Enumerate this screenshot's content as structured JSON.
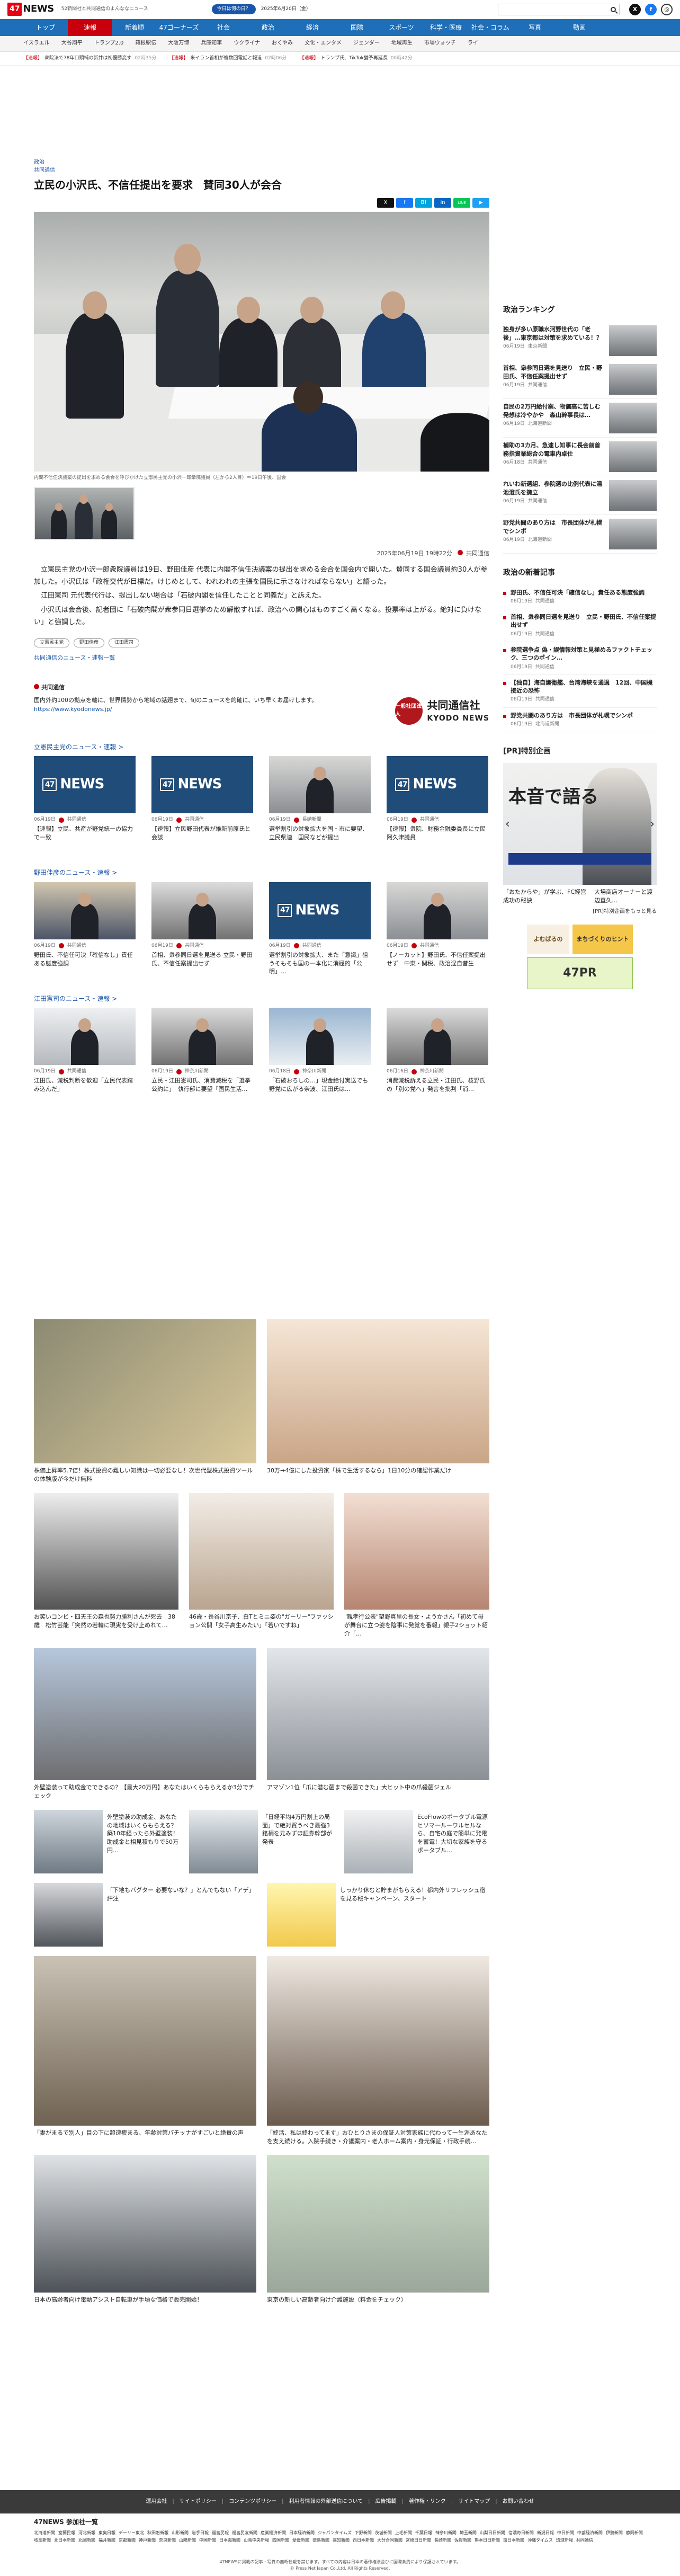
{
  "header": {
    "logo_num": "47",
    "logo_text": "NEWS",
    "tagline": "52新聞社と共同通信のよんななニュース",
    "today_btn": "今日は何の日？",
    "date": "2025年6月20日（金）",
    "search_placeholder": ""
  },
  "nav": {
    "items": [
      "トップ",
      "速報",
      "新着順",
      "47ゴーナーズ",
      "社会",
      "政治",
      "経済",
      "国際",
      "スポーツ",
      "科学・医療",
      "社会・コラム",
      "写真",
      "動画"
    ],
    "active": "速報"
  },
  "subnav": [
    "イスラエル",
    "大谷翔平",
    "トランプ2.0",
    "箱根駅伝",
    "大阪万博",
    "兵庫知事",
    "ウクライナ",
    "おくやみ",
    "文化・エンタメ",
    "ジェンダー",
    "地域再生",
    "市場ウォッチ",
    "ライ"
  ],
  "ticker": [
    {
      "tag": "【速報】",
      "text": "衆院法で78年口頭補の新井は初優勝変す",
      "time": "02時35分"
    },
    {
      "tag": "【速報】",
      "text": "米イラン首相が複数回電話と報道",
      "time": "02時06分"
    },
    {
      "tag": "【速報】",
      "text": "トランプ氏、TikTok猶予再延長",
      "time": "00時42分"
    }
  ],
  "article": {
    "cats": [
      "政治",
      "共同通信"
    ],
    "headline": "立民の小沢氏、不信任提出を要求　賛同30人が会合",
    "caption": "内閣不信任決議案の提出を求める会合を呼びかけた立憲民主党の小沢一郎衆院議員（左から2人目）＝19日午後、国会",
    "byline_date": "2025年06月19日 19時22分",
    "byline_src": "共同通信",
    "paragraphs": [
      "立憲民主党の小沢一郎衆院議員は19日、野田佳彦 代表に内閣不信任決議案の提出を求める会合を国会内で開いた。賛同する国会議員約30人が参加した。小沢氏は「政権交代が目標だ。けじめとして、われわれの主張を国民に示さなければならない」と語った。",
      "江田憲司 元代表代行は、提出しない場合は「石破内閣を信任したことと同義だ」と訴えた。",
      "小沢氏は会合後、記者団に「石破内閣が衆参同日選挙のため解散すれば、政治への関心はものすごく高くなる。投票率は上がる。絶対に負けない」と強調した。"
    ],
    "tags": [
      "立憲民主党",
      "野田佳彦",
      "江田憲司"
    ],
    "more_link": "共同通信のニュース・速報一覧"
  },
  "share": [
    "X",
    "f",
    "B!",
    "in",
    "LINE",
    "▶"
  ],
  "kyodo": {
    "title": "共同通信",
    "desc": "国内外約100の拠点を軸に、世界情勢から地域の話題まで、旬のニュースを的確に、いち早くお届けします。",
    "url": "https://www.kyodonews.jp/",
    "logo_circle": "一般社団法人",
    "logo_name": "共同通信社",
    "logo_en": "KYODO NEWS"
  },
  "sections": [
    {
      "title": "立憲民主党のニュース・速報 >",
      "cards": [
        {
          "img": "logo",
          "date": "06月19日",
          "src": "共同通信",
          "title": "【速報】立民、共産が野党統一の協力で一致"
        },
        {
          "img": "logo",
          "date": "06月19日",
          "src": "共同通信",
          "title": "【速報】立民野田代表が維新前原氏と会談"
        },
        {
          "img": "photo",
          "date": "06月19日",
          "src": "長崎新聞",
          "title": "選挙割引の対象拡大を国・市に要望、立民県連　国民などが提出"
        },
        {
          "img": "logo",
          "date": "06月19日",
          "src": "共同通信",
          "title": "【速報】衆院、財務金融委員長に立民阿久津議員"
        }
      ]
    },
    {
      "title": "野田佳彦のニュース・速報 >",
      "cards": [
        {
          "img": "photo2",
          "date": "06月19日",
          "src": "共同通信",
          "title": "野田氏、不信任可決「確信なし」責任ある態度強調"
        },
        {
          "img": "photo5",
          "date": "06月19日",
          "src": "共同通信",
          "title": "首相、衆参同日選を見送る 立民・野田氏、不信任案提出せず"
        },
        {
          "img": "logo",
          "date": "06月19日",
          "src": "共同通信",
          "title": "選挙割引の対象拡大、また「意識」狙うそもそも国の一本化に消極的「公明」…"
        },
        {
          "img": "photo",
          "date": "06月19日",
          "src": "共同通信",
          "title": "【ノーカット】野田氏、不信任案提出せず　中東・関税、政治混自昔生"
        }
      ]
    },
    {
      "title": "江田憲司のニュース・速報 >",
      "cards": [
        {
          "img": "photo3",
          "date": "06月19日",
          "src": "共同通信",
          "title": "江田氏、減税判断を歓迎「立民代表踏み込んだ」"
        },
        {
          "img": "photo5",
          "date": "06月19日",
          "src": "神奈川新聞",
          "title": "立民・江田憲司氏、消費減税を「選挙公約に」　執行部に要望「国民生活…"
        },
        {
          "img": "photo4",
          "date": "06月18日",
          "src": "神奈川新聞",
          "title": "「石破おろしの…」現金給付実送でも野党に広がる奈波、江田氏は…"
        },
        {
          "img": "photo5",
          "date": "06月16日",
          "src": "神奈川新聞",
          "title": "消費減税訴える立民・江田氏、枝野氏の「別の党へ」発言を批判「消…"
        }
      ]
    }
  ],
  "ads": [
    {
      "title": "株価上昇率5.7倍！株式投資の難しい知識は一切必要なし！次世代型株式投資ツールの体験版が今だけ無料"
    },
    {
      "title": "30万→4億にした投資家「株で生活するなら」1日10分の確認作業だけ"
    },
    {
      "title": "お笑いコンビ・四天王の森也努力勝利さんが死去　38歳　松竹芸能「突然の若輪に現実を受け止めれて…"
    },
    {
      "title": "46歳・長谷川京子、白Tとミニ姿の\"ガーリー\"ファッション公開「女子高生みたい」「若いですね」"
    },
    {
      "title": "\"親孝行公表\"望野真里の長女・ようかさん「初めて母が舞台に立つ姿を陰事に発覚を番報」親子2ショット紹介「…"
    },
    {
      "title": "外壁塗装って助成金でできるの？【最大20万円】あなたはいくらもらえるか3分でチェック"
    },
    {
      "title": "アマゾン1位「爪に潜む菌まで殺菌できた」大ヒット中の爪殺菌ジェル"
    },
    {
      "title": "外壁塗装の助成金、あなたの地域はいくらもらえる？築10年経ったら外壁塗装！助成金と相見積もりで50万円…"
    },
    {
      "title": "「日経平均4万円割上の局面」で絶対買うべき最強3銘柄を元みずほ証券幹部が発表"
    },
    {
      "title": "EcoFlowのポータブル電源ヒソマ一ルーワルセルなら、自宅の庭で簡単に発電を蓄電！大切な家族を守るポータブル…"
    },
    {
      "title": "「下地もバグター 必要ないな？」とんでもない「アデ」評注"
    },
    {
      "title": "しっかり休むと貯まがもらえる！都内外リフレッシュ宿を見る秘キャンペーン、スタート"
    },
    {
      "title": "「妻がまるで別人」目の下に超速疲まる、年齢対策パチッナがすごいと絶賛の声"
    },
    {
      "title": "「終活、私は終わってます」おひとりさまの保証人対策家族に代わって一生涯あなたを支え続ける。入院手続き・介護案内・老人ホーム案内・身元保証・行政手続…"
    },
    {
      "title": "日本の高齢者向け電動アシスト自転車が手頃な価格で販売開始！"
    },
    {
      "title": "東京の新しい高齢者向け介護施設（料金をチェック）"
    }
  ],
  "sidebar": {
    "ranking_title": "政治ランキング",
    "ranking": [
      {
        "title": "独身が多い原職水河野世代の「老後」…東京都は対策を求めている！？",
        "date": "06月19日",
        "src": "東京新聞"
      },
      {
        "title": "首相、衆参同日選を見送り　立民・野田氏、不信任案提出せず",
        "date": "06月19日",
        "src": "共同通信"
      },
      {
        "title": "自民の2万円給付案、物価高に苦しむ発想は冷やかや　森山幹事長は…",
        "date": "06月19日",
        "src": "北海道新聞"
      },
      {
        "title": "補助の3カ月、急速し知事に長会前首務指資業総合の電車内卓仕",
        "date": "06月18日",
        "src": "共同通信"
      },
      {
        "title": "れいわ新選組、参院選の比例代表に湯池澄氏を擁立",
        "date": "06月19日",
        "src": "共同通信"
      },
      {
        "title": "野党共闘のあり方は　市長団体が札幌でシンポ",
        "date": "06月19日",
        "src": "北海道新聞"
      }
    ],
    "new_title": "政治の新着記事",
    "new": [
      {
        "title": "野田氏、不信任可決「確信なし」責任ある態度強調",
        "date": "06月19日",
        "src": "共同通信"
      },
      {
        "title": "首相、衆参同日選を見送り　立民・野田氏、不信任案提出せず",
        "date": "06月19日",
        "src": "共同通信"
      },
      {
        "title": "参院選争点 偽・誤情報対策と見極めるファクトチェック、三つのポイン…",
        "date": "06月19日",
        "src": "共同通信"
      },
      {
        "title": "【独自】海自護衛艦、台湾海峡を通過　12回、中国機接近の恐怖",
        "date": "06月19日",
        "src": "共同通信"
      },
      {
        "title": "野党共闘のあり方は　市長団体が札幌でシンポ",
        "date": "06月19日",
        "src": "北海道新聞"
      }
    ],
    "pr_title": "[PR]特別企画",
    "pr_banner_text": "本音で語る",
    "pr_caption1": "「おたからや」が学ぶ、FC経営成功の秘訣",
    "pr_caption2": "大場商店オーナーと渡辺直久…",
    "pr_more": "[PR]特別企画をもっと見る",
    "pr_logo1": "よむぱるの",
    "pr_logo2": "まちづくりのヒント",
    "pr_logo3": "47PR"
  },
  "footer": {
    "nav": [
      "運用会社",
      "サイトポリシー",
      "コンテンツポリシー",
      "利用者情報の外部送信について",
      "広告掲載",
      "著作権・リンク",
      "サイトマップ",
      "お問い合わせ"
    ],
    "members_title": "47NEWS 参加社一覧",
    "members": [
      "北海道新聞",
      "室蘭民報",
      "河北新報",
      "東奥日報",
      "デーリー東北",
      "秋田魁新報",
      "山形新聞",
      "岩手日報",
      "福島民報",
      "福島民友新聞",
      "産業経済新聞",
      "日本経済新聞",
      "ジャパンタイムズ",
      "下野新聞",
      "茨城新聞",
      "上毛新聞",
      "千葉日報",
      "神奈川新聞",
      "埼玉新聞",
      "山梨日日新聞",
      "信濃毎日新聞",
      "新潟日報",
      "中日新聞",
      "中部経済新聞",
      "伊勢新聞",
      "静岡新聞",
      "岐阜新聞",
      "北日本新聞",
      "北國新聞",
      "福井新聞",
      "京都新聞",
      "神戸新聞",
      "奈良新聞",
      "山陽新聞",
      "中国新聞",
      "日本海新聞",
      "山陰中央新報",
      "四国新聞",
      "愛媛新聞",
      "徳島新聞",
      "高知新聞",
      "西日本新聞",
      "大分合同新聞",
      "宮崎日日新聞",
      "長崎新聞",
      "佐賀新聞",
      "熊本日日新聞",
      "南日本新聞",
      "沖縄タイムス",
      "琉球新報",
      "共同通信"
    ],
    "copyright1": "47NEWSに掲載の記事・写真の無断転載を禁じます。すべての内容は日本の著作権法並びに国際条約により保護されています。",
    "copyright2": "© Press Net Japan Co.,Ltd. All Rights Reserved."
  }
}
